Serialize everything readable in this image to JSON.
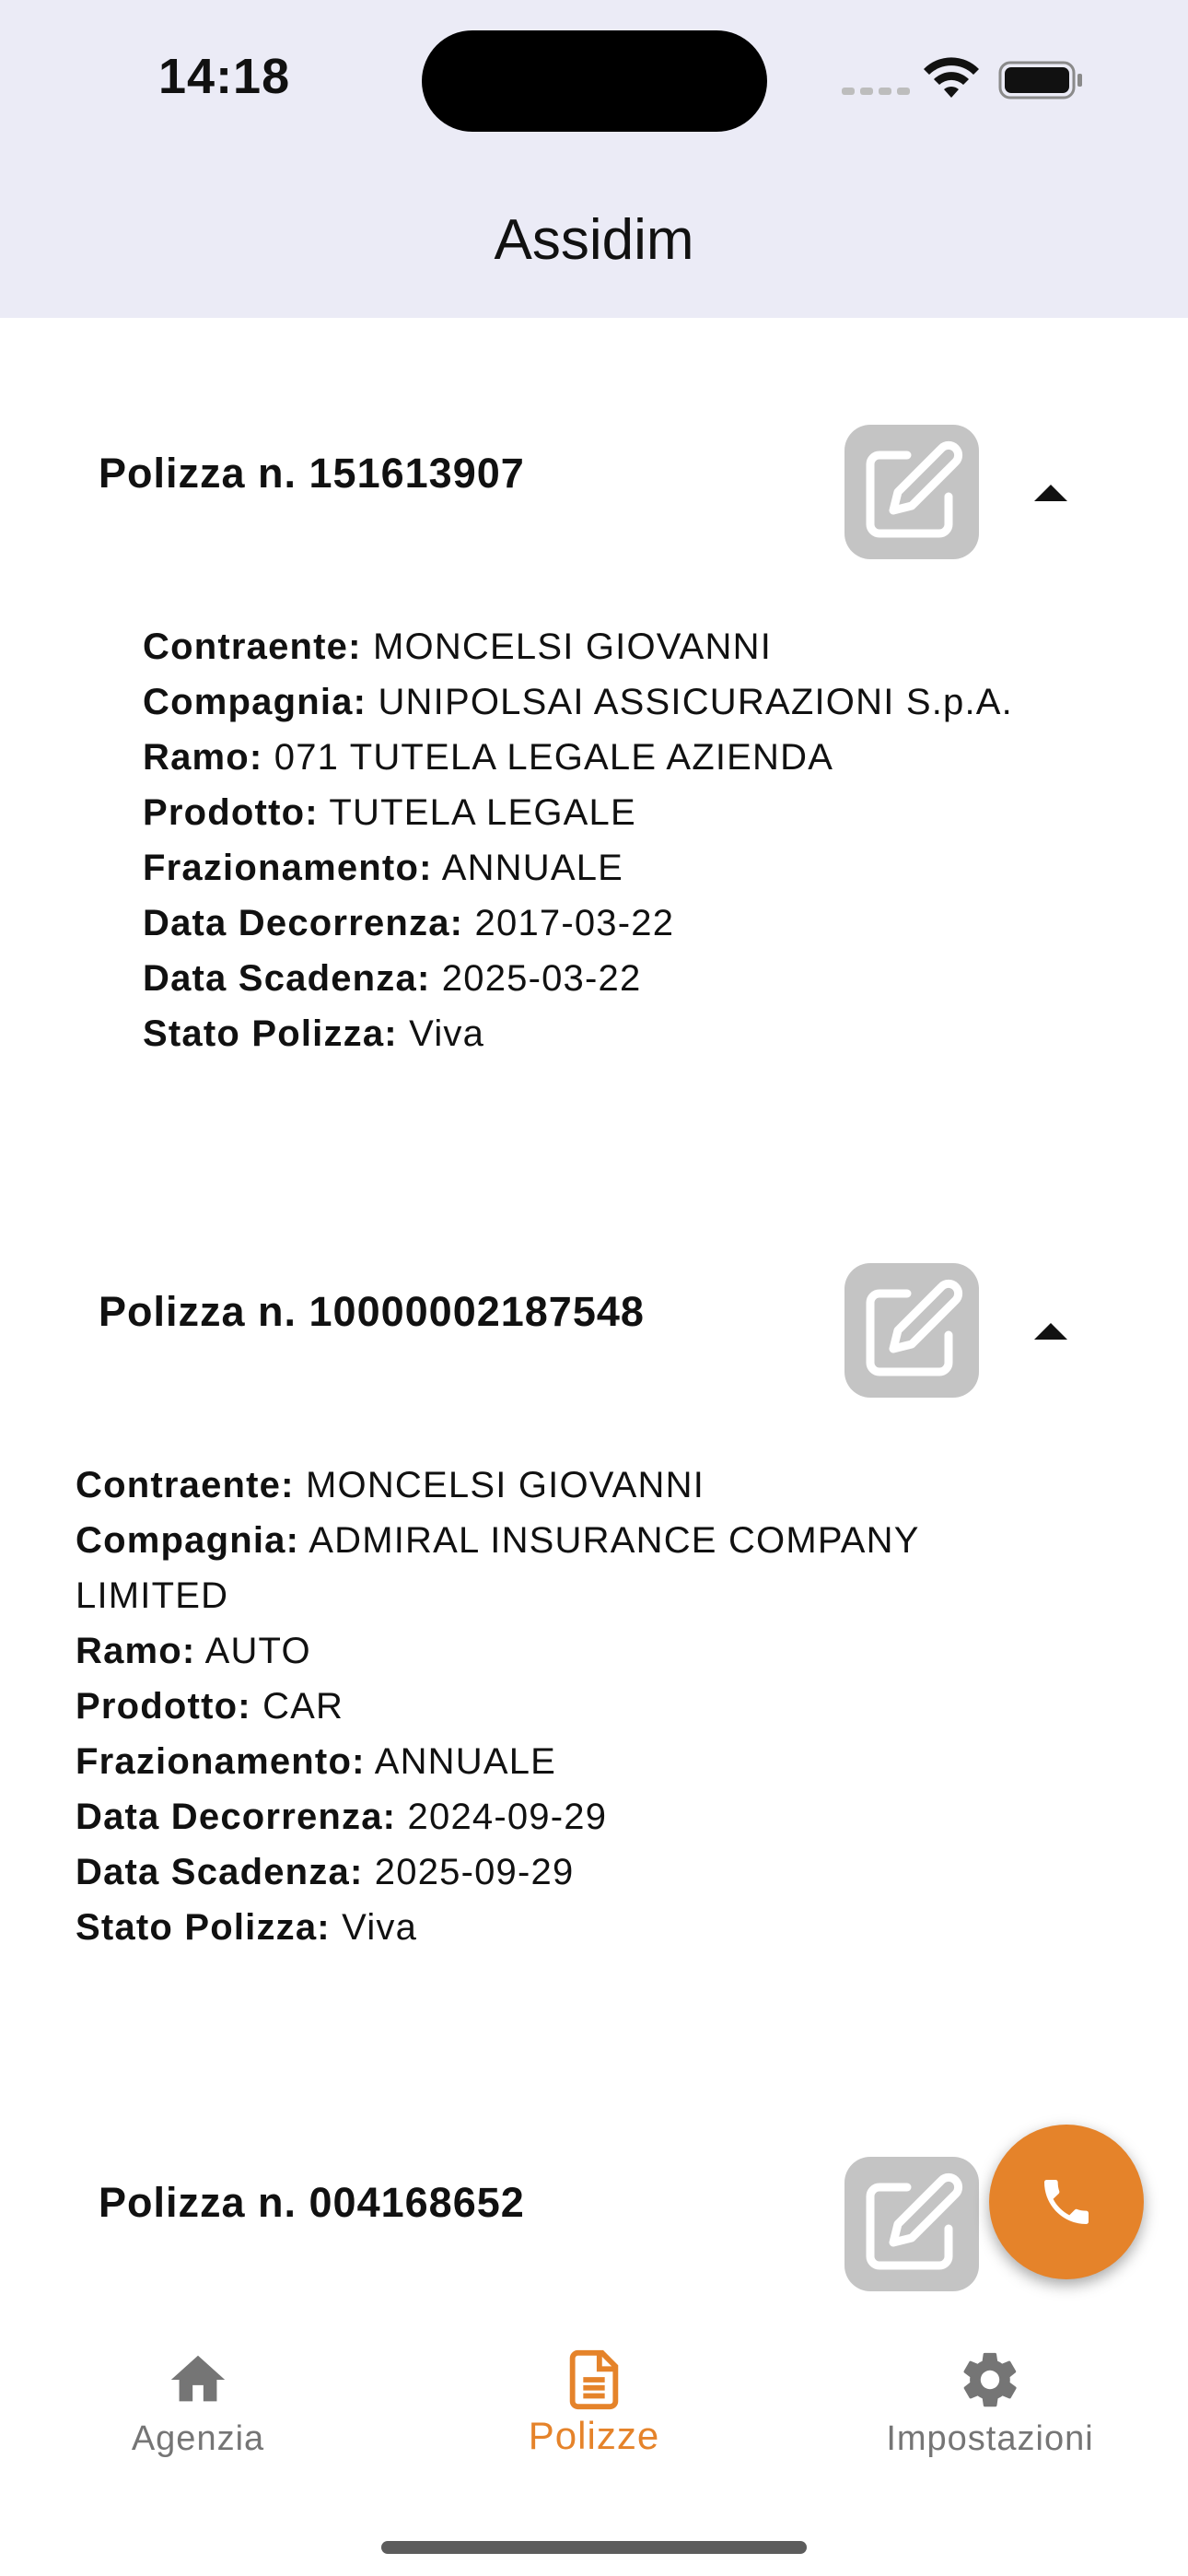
{
  "status_bar": {
    "time": "14:18"
  },
  "header": {
    "title": "Assidim"
  },
  "policies": [
    {
      "title": "Polizza n. 151613907",
      "fields": [
        {
          "label": "Contraente:",
          "value": "MONCELSI GIOVANNI"
        },
        {
          "label": "Compagnia:",
          "value": "UNIPOLSAI ASSICURAZIONI S.p.A."
        },
        {
          "label": "Ramo:",
          "value": "071 TUTELA LEGALE AZIENDA"
        },
        {
          "label": "Prodotto:",
          "value": "TUTELA LEGALE"
        },
        {
          "label": "Frazionamento:",
          "value": "ANNUALE"
        },
        {
          "label": "Data Decorrenza:",
          "value": "2017-03-22"
        },
        {
          "label": "Data Scadenza:",
          "value": "2025-03-22"
        },
        {
          "label": "Stato Polizza:",
          "value": "Viva"
        }
      ]
    },
    {
      "title": "Polizza n. 10000002187548",
      "fields": [
        {
          "label": "Contraente:",
          "value": "MONCELSI GIOVANNI"
        },
        {
          "label": "Compagnia:",
          "value": "ADMIRAL INSURANCE COMPANY"
        },
        {
          "label": "",
          "value": "LIMITED"
        },
        {
          "label": "Ramo:",
          "value": "AUTO"
        },
        {
          "label": "Prodotto:",
          "value": "CAR"
        },
        {
          "label": "Frazionamento:",
          "value": "ANNUALE"
        },
        {
          "label": "Data Decorrenza:",
          "value": "2024-09-29"
        },
        {
          "label": "Data Scadenza:",
          "value": "2025-09-29"
        },
        {
          "label": "Stato Polizza:",
          "value": "Viva"
        }
      ]
    },
    {
      "title": "Polizza n. 004168652"
    }
  ],
  "tabs": [
    {
      "label": "Agenzia",
      "icon": "home-icon"
    },
    {
      "label": "Polizze",
      "icon": "document-icon",
      "active": true
    },
    {
      "label": "Impostazioni",
      "icon": "gear-icon"
    }
  ],
  "colors": {
    "accent": "#e5832a",
    "header_bg": "#ebebf6",
    "edit_button": "#c4c4c4"
  }
}
